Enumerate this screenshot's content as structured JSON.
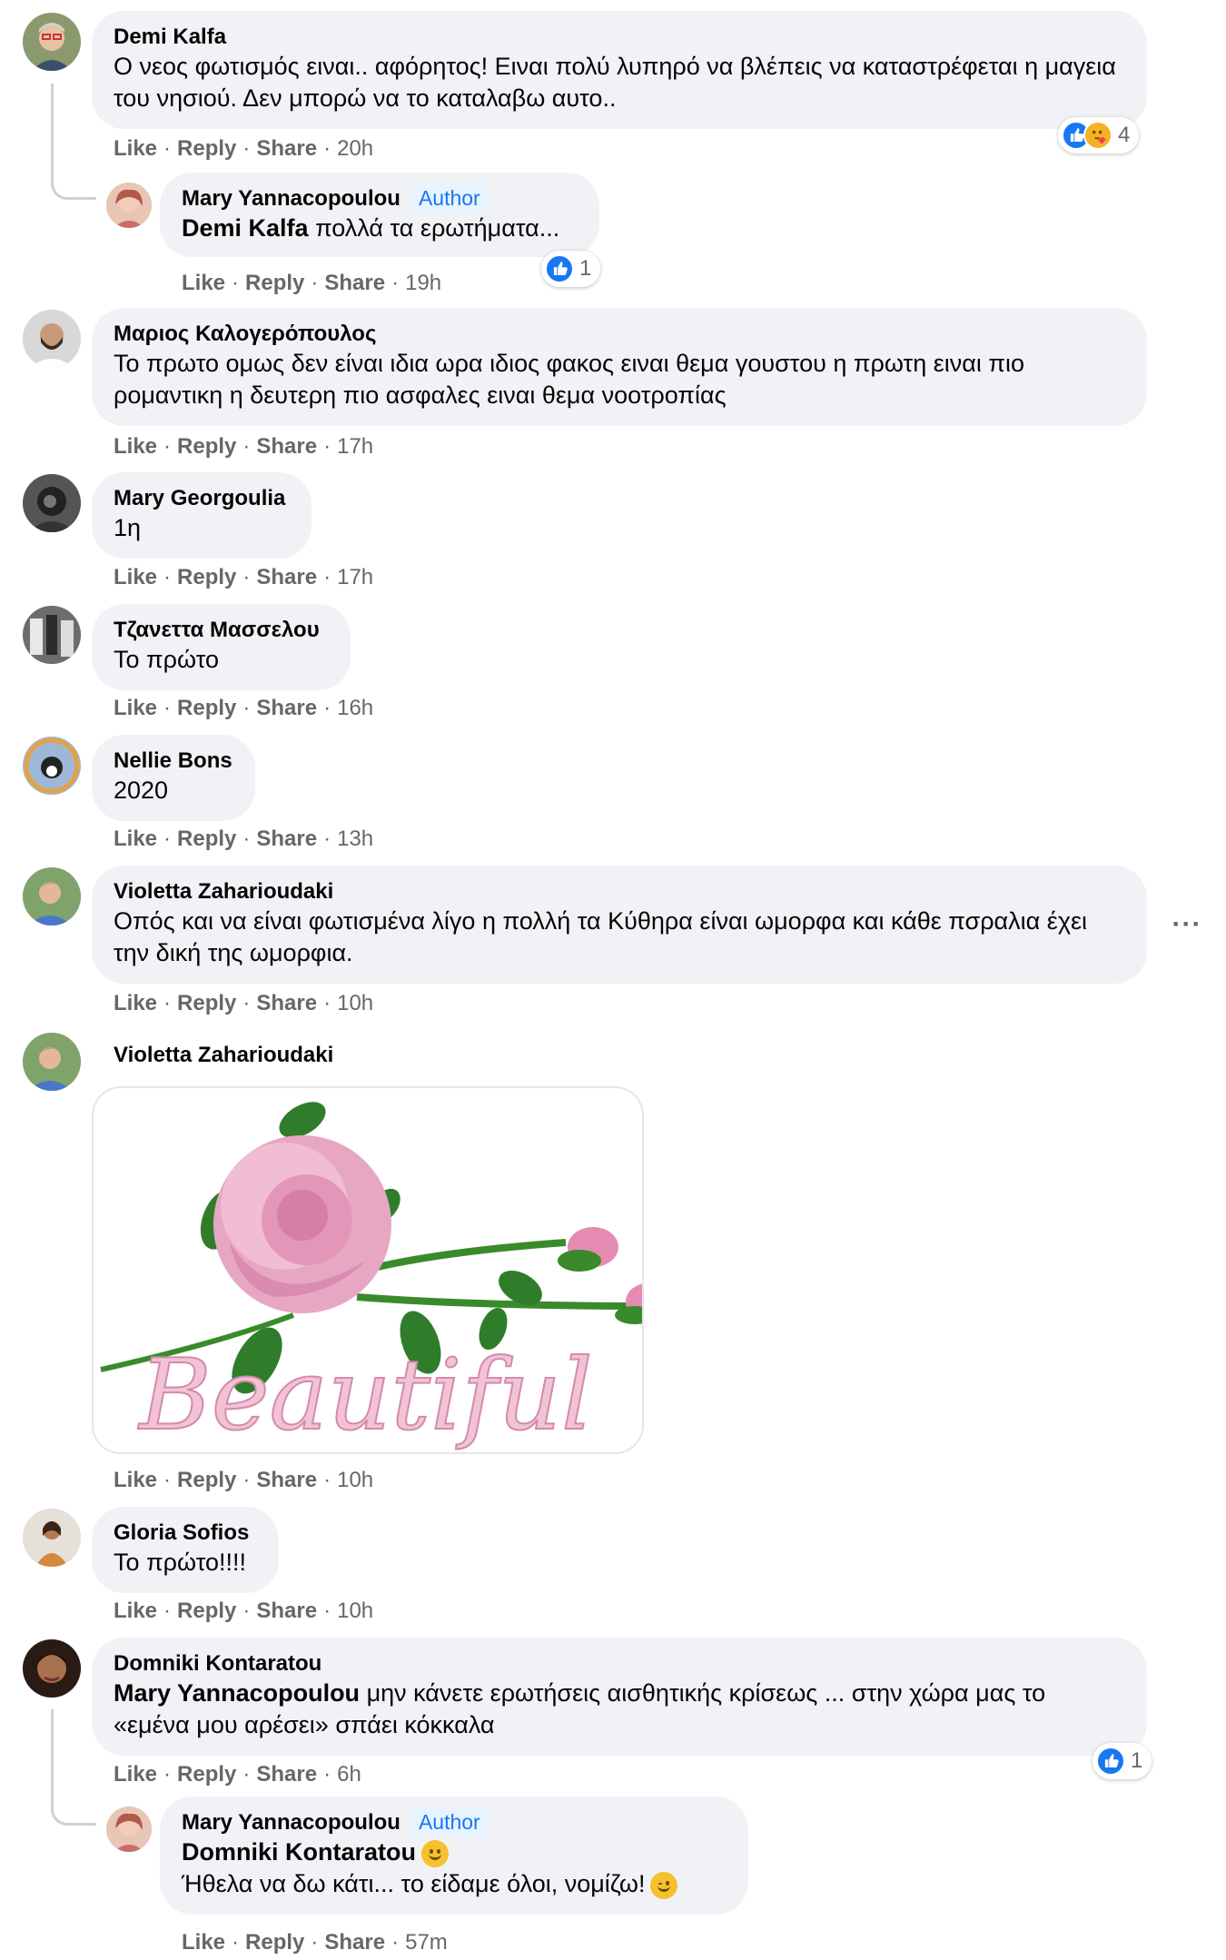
{
  "comments": [
    {
      "name": "Demi Kalfa",
      "text": "Ο νεος φωτισμός ειναι.. αφόρητος! Ειναι πολύ λυπηρό να βλέπεις να καταστρέφεται η μαγεια του νησιού. Δεν μπορώ να το καταλαβω αυτο..",
      "actions": {
        "like": "Like",
        "reply": "Reply",
        "share": "Share",
        "time": "20h"
      },
      "reactions": {
        "count": "4",
        "types": [
          "like",
          "care"
        ]
      },
      "reply": {
        "name": "Mary Yannacopoulou",
        "badge": "Author",
        "mention": "Demi Kalfa",
        "text": " πολλά τα ερωτήματα...",
        "actions": {
          "like": "Like",
          "reply": "Reply",
          "share": "Share",
          "time": "19h"
        },
        "reactions": {
          "count": "1",
          "types": [
            "like"
          ]
        }
      }
    },
    {
      "name": "Μαριος Καλογερόπουλος",
      "text": "Το πρωτο ομως δεν είναι ιδια ωρα ιδιος φακος ειναι θεμα γουστου η πρωτη ειναι πιο ρομαντικη η δευτερη πιο ασφαλες ειναι θεμα νοοτροπίας",
      "actions": {
        "like": "Like",
        "reply": "Reply",
        "share": "Share",
        "time": "17h"
      }
    },
    {
      "name": "Mary Georgoulia",
      "text": "1η",
      "actions": {
        "like": "Like",
        "reply": "Reply",
        "share": "Share",
        "time": "17h"
      }
    },
    {
      "name": "Τζανεττα Μασσελου",
      "text": "Το πρώτο",
      "actions": {
        "like": "Like",
        "reply": "Reply",
        "share": "Share",
        "time": "16h"
      }
    },
    {
      "name": "Nellie Bons",
      "text": "2020",
      "actions": {
        "like": "Like",
        "reply": "Reply",
        "share": "Share",
        "time": "13h"
      }
    },
    {
      "name": "Violetta Zaharioudaki",
      "text": "Οπός και να είναι φωτισμένα λίγο η πολλή τα Κύθηρα είναι ωμορφα και κάθε πσραλια έχει την δική της ωμορφια.",
      "actions": {
        "like": "Like",
        "reply": "Reply",
        "share": "Share",
        "time": "10h"
      },
      "more_icon": "more-horizontal-icon"
    },
    {
      "name": "Violetta Zaharioudaki",
      "attachment": {
        "kind": "sticker",
        "caption": "Beautiful",
        "icon": "rose-icon"
      },
      "actions": {
        "like": "Like",
        "reply": "Reply",
        "share": "Share",
        "time": "10h"
      }
    },
    {
      "name": "Gloria Sofios",
      "text": "Το πρώτο!!!!",
      "actions": {
        "like": "Like",
        "reply": "Reply",
        "share": "Share",
        "time": "10h"
      }
    },
    {
      "name": "Domniki Kontaratou",
      "mention": "Mary Yannacopoulou",
      "text": " μην κάνετε ερωτήσεις αισθητικής κρίσεως ... στην χώρα μας το «εμένα μου αρέσει» σπάει κόκκαλα",
      "actions": {
        "like": "Like",
        "reply": "Reply",
        "share": "Share",
        "time": "6h"
      },
      "reactions": {
        "count": "1",
        "types": [
          "like"
        ]
      },
      "reply": {
        "name": "Mary Yannacopoulou",
        "badge": "Author",
        "mention": "Domniki Kontaratou",
        "text": "Ήθελα να δω κάτι... το είδαμε όλοι, νομίζω!",
        "emojis": [
          "slightly-smiling-emoji",
          "winking-emoji"
        ],
        "actions": {
          "like": "Like",
          "reply": "Reply",
          "share": "Share",
          "time": "57m"
        }
      }
    }
  ],
  "colors": {
    "bubble": "#f0f2f5",
    "meta": "#65676b",
    "accent": "#1877f2",
    "badge_bg": "#e7f3ff"
  }
}
